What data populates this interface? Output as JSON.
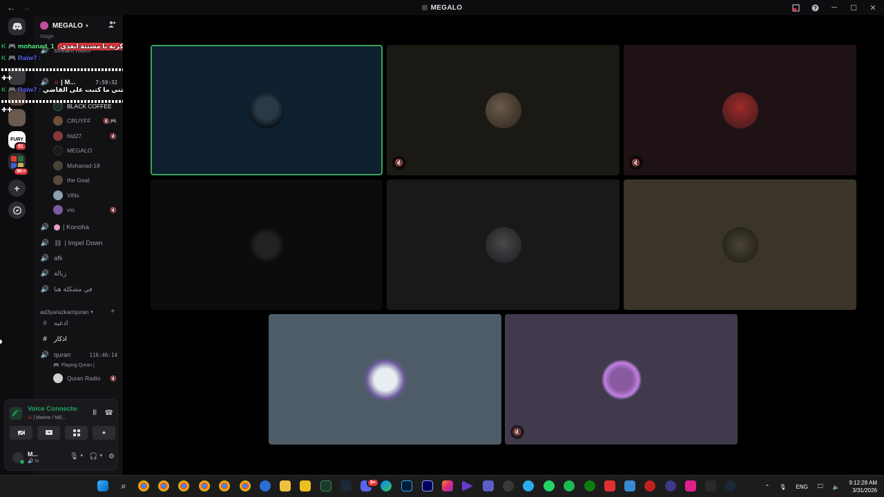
{
  "window": {
    "title": "MEGALO"
  },
  "server": {
    "name": "MEGALO"
  },
  "overlay": {
    "line1_user": "mohanad_1",
    "line1_text": "كرية يا مشتتة ابعدي",
    "line2_user": "Raiw7 :",
    "line3_user": "Raiw7 :",
    "line3_text": "ليتني ما كتبت على القاضي"
  },
  "channels": {
    "stage_label": "stage",
    "stream_room": "stream room",
    "active_channel": "| M...",
    "active_timer": "7:59:32",
    "members": [
      {
        "name": "BLACK COFFEE",
        "status": ""
      },
      {
        "name": "CRUYFF",
        "status": "🔇🎮"
      },
      {
        "name": "htd27",
        "status": "🔇"
      },
      {
        "name": "MEGALO",
        "status": ""
      },
      {
        "name": "Mohanad-18",
        "status": ""
      },
      {
        "name": "the Goat",
        "status": ""
      },
      {
        "name": "ViNx",
        "status": ""
      },
      {
        "name": "vio",
        "status": "🔇"
      }
    ],
    "konoha": "| Konoha",
    "impel_down": "| Impel Down",
    "afk": "afk",
    "zbalah": "زبالة",
    "problem": "في مشكلة هنا",
    "category": "ad3ya/azkar/quran",
    "text_ch_1": "ادعيه",
    "text_ch_2": "اذكار",
    "quran": "quran",
    "quran_timer": "116:46:14",
    "quran_activity": "Playing Quran |",
    "quran_radio": "Quran Radio"
  },
  "voice": {
    "title": "Voice Connected",
    "subtitle": "| Marine / ME...",
    "user_name": "M...",
    "user_status": "In"
  },
  "rail": {
    "fury_label": "FURY",
    "fury_badge": "91",
    "group_badge": "9K+"
  },
  "taskbar": {
    "lang": "ENG",
    "time": "9:12:28 AM",
    "date": "3/31/2026",
    "discord_badge": "9+"
  },
  "colors": {
    "accent_green": "#23a55a",
    "speaking_border": "#3ba55c",
    "tile_1": "#0f2030",
    "tile_2": "#1b1913",
    "tile_3": "#1f1215",
    "tile_4": "#0c0c0c",
    "tile_5": "#1a1818",
    "tile_6": "#3b3529",
    "tile_7": "#4d5c66",
    "tile_8": "#403a4c"
  },
  "tiles": [
    {
      "name": "tile-1",
      "speaking": true,
      "muted": false
    },
    {
      "name": "tile-2",
      "speaking": false,
      "muted": true
    },
    {
      "name": "tile-3",
      "speaking": false,
      "muted": true
    },
    {
      "name": "tile-4",
      "speaking": false,
      "muted": false
    },
    {
      "name": "tile-5",
      "speaking": false,
      "muted": false
    },
    {
      "name": "tile-6",
      "speaking": false,
      "muted": false
    },
    {
      "name": "tile-7",
      "speaking": false,
      "muted": false
    },
    {
      "name": "tile-8",
      "speaking": false,
      "muted": true
    }
  ]
}
